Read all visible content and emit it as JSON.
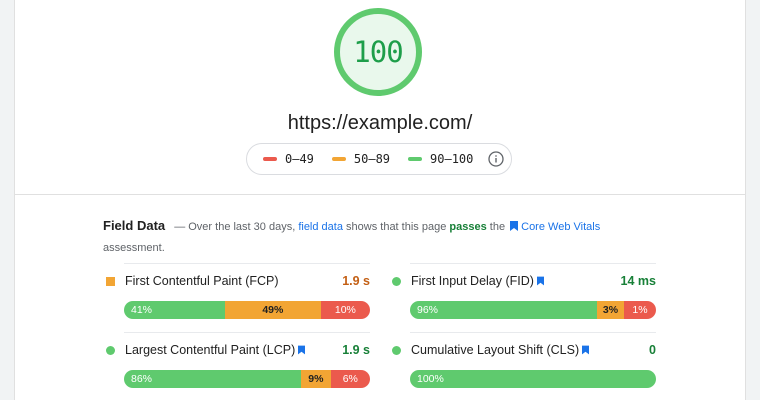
{
  "score": {
    "value": "100",
    "color": "#5fca6e"
  },
  "url": "https://example.com/",
  "legend": {
    "items": [
      {
        "label": "0–49",
        "color": "#eb5a4d"
      },
      {
        "label": "50–89",
        "color": "#f2a534"
      },
      {
        "label": "90–100",
        "color": "#5fca6e"
      }
    ],
    "info_icon": "info-icon"
  },
  "field": {
    "title": "Field Data",
    "dash": "—",
    "text1": "Over the last 30 days,",
    "link1": "field data",
    "text2": "shows that this page",
    "status": "passes",
    "text3": "the",
    "link2": "Core Web Vitals",
    "text4": "assessment."
  },
  "metrics": [
    {
      "name": "First Contentful Paint (FCP)",
      "value": "1.9 s",
      "marker": "square-orange",
      "core": false,
      "distribution": {
        "good": "41%",
        "average": "49%",
        "poor": "10%"
      }
    },
    {
      "name": "First Input Delay (FID)",
      "value": "14 ms",
      "marker": "circle-green",
      "core": true,
      "distribution": {
        "good": "96%",
        "average": "3%",
        "poor": "1%"
      }
    },
    {
      "name": "Largest Contentful Paint (LCP)",
      "value": "1.9 s",
      "marker": "circle-green",
      "core": true,
      "distribution": {
        "good": "86%",
        "average": "9%",
        "poor": "6%"
      }
    },
    {
      "name": "Cumulative Layout Shift (CLS)",
      "value": "0",
      "marker": "circle-green",
      "core": true,
      "distribution": {
        "good": "100%"
      }
    }
  ],
  "colors": {
    "good": "#5fca6e",
    "average": "#f2a534",
    "poor": "#eb5a4d",
    "link": "#1a73e8",
    "pass": "#188038"
  }
}
